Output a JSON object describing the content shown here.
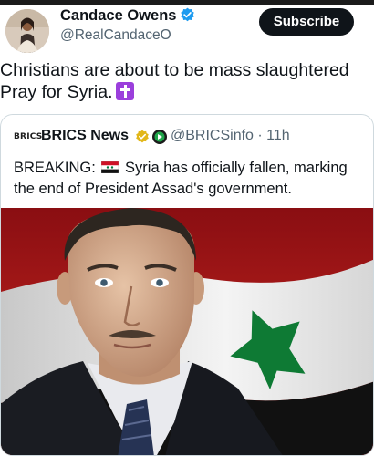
{
  "author": {
    "name": "Candace Owens",
    "handle": "@RealCandaceO",
    "verified_icon": "verified-badge-icon"
  },
  "subscribe_label": "Subscribe",
  "tweet": {
    "line1": "Christians are about to be mass slaughtered",
    "line2": "Pray for Syria.",
    "emoji_icon": "latin-cross-icon"
  },
  "quote": {
    "logo_text": "BRICS",
    "name": "BRICS News",
    "handle_time": "@BRICSinfo · 11h",
    "text_prefix": "BREAKING:",
    "text_body": "Syria has officially fallen, marking the end of President Assad's government.",
    "flag_icon": "syria-flag-icon"
  },
  "colors": {
    "text": "#0f1419",
    "muted": "#536471",
    "verified": "#1d9bf0",
    "subscribe_bg": "#0f1419",
    "flag_red": "#ce1126",
    "flag_green": "#007a3d",
    "emoji_purple": "#9b3fdc"
  }
}
